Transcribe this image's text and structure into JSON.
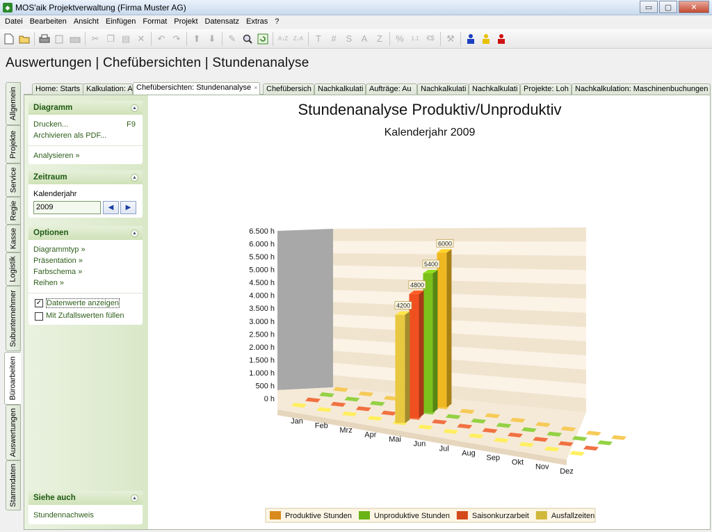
{
  "window": {
    "title": "MOS'aik Projektverwaltung (Firma Muster AG)",
    "app_icon": "app-logo-icon",
    "minimize": "▭",
    "maximize": "▢",
    "close": "✕"
  },
  "menu": [
    "Datei",
    "Bearbeiten",
    "Ansicht",
    "Einfügen",
    "Format",
    "Projekt",
    "Datensatz",
    "Extras",
    "?"
  ],
  "toolbar": {
    "icons": [
      "new-document-icon",
      "open-folder-icon",
      "print-icon",
      "print-preview-icon",
      "print-setup-icon",
      "cut-icon",
      "copy-icon",
      "paste-icon",
      "delete-icon",
      "undo-icon",
      "redo-icon",
      "move-up-icon",
      "move-down-icon",
      "edit-icon",
      "search-icon",
      "refresh-icon",
      "sort-ascending-icon",
      "sort-descending-icon",
      "text-format-icon",
      "hash-format-icon",
      "s-format-icon",
      "a-format-icon",
      "z-format-icon",
      "percent-icon",
      "decimal-format-icon",
      "currency-icon",
      "tools-icon",
      "user-blue-icon",
      "user-yellow-icon",
      "user-red-icon"
    ],
    "text_labels": {
      "sort_asc": "A↓Z",
      "sort_desc": "Z↓A",
      "T": "T",
      "hash": "#",
      "S": "S",
      "A": "A",
      "Z": "Z",
      "percent": "%",
      "decimal": "1.1",
      "currency": "€$"
    }
  },
  "breadcrumb": "Auswertungen | Chefübersichten | Stundenanalyse",
  "vertical_tabs": [
    "Allgemein",
    "Projekte",
    "Service",
    "Regie",
    "Kasse",
    "Logistik",
    "Subunternehmer",
    "Büroarbeiten",
    "Auswertungen",
    "Stammdaten"
  ],
  "active_vertical_tab": "Büroarbeiten",
  "tabs": [
    {
      "label": "Home: Starts",
      "active": false
    },
    {
      "label": "Kalkulation: A",
      "active": false
    },
    {
      "label": "Chefübersichten: Stundenanalyse",
      "active": true
    },
    {
      "label": "Chefübersich",
      "active": false
    },
    {
      "label": "Nachkalkulati",
      "active": false
    },
    {
      "label": "Aufträge: Au",
      "active": false
    },
    {
      "label": "Nachkalkulati",
      "active": false
    },
    {
      "label": "Nachkalkulati",
      "active": false
    },
    {
      "label": "Projekte: Loh",
      "active": false
    },
    {
      "label": "Nachkalkulation: Maschinenbuchungen",
      "active": false
    }
  ],
  "tab_close_glyph": "×",
  "sidebar": {
    "diagramm": {
      "title": "Diagramm",
      "print_label": "Drucken...",
      "print_key": "F9",
      "archive_label": "Archivieren als PDF...",
      "analyze_label": "Analysieren »"
    },
    "zeitraum": {
      "title": "Zeitraum",
      "year_label": "Kalenderjahr",
      "year_value": "2009",
      "prev_glyph": "◀",
      "next_glyph": "▶"
    },
    "optionen": {
      "title": "Optionen",
      "links": [
        "Diagrammtyp »",
        "Präsentation »",
        "Farbschema »",
        "Reihen »"
      ],
      "show_values_label": "Datenwerte anzeigen",
      "show_values_checked": true,
      "random_values_label": "Mit Zufallswerten füllen",
      "random_values_checked": false
    },
    "siehe_auch": {
      "title": "Siehe auch",
      "links": [
        "Stundennachweis"
      ]
    }
  },
  "chart_data": {
    "type": "bar",
    "title": "Stundenanalyse Produktiv/Unproduktiv",
    "subtitle": "Kalenderjahr 2009",
    "categories": [
      "Jan",
      "Feb",
      "Mrz",
      "Apr",
      "Mai",
      "Jun",
      "Jul",
      "Aug",
      "Sep",
      "Okt",
      "Nov",
      "Dez"
    ],
    "y_ticks": [
      "0 h",
      "500 h",
      "1.000 h",
      "1.500 h",
      "2.000 h",
      "2.500 h",
      "3.000 h",
      "3.500 h",
      "4.000 h",
      "4.500 h",
      "5.000 h",
      "5.500 h",
      "6.000 h",
      "6.500 h"
    ],
    "ylim": [
      0,
      6500
    ],
    "series": [
      {
        "name": "Produktive Stunden",
        "color": "#f0b820",
        "values": [
          0,
          0,
          0,
          0,
          6000,
          0,
          0,
          0,
          0,
          0,
          0,
          0
        ],
        "labels": [
          "",
          "",
          "",
          "",
          "6000",
          "",
          "",
          "",
          "",
          "",
          "",
          ""
        ]
      },
      {
        "name": "Unproduktive Stunden",
        "color": "#7cc01c",
        "values": [
          0,
          0,
          0,
          0,
          5400,
          0,
          0,
          0,
          0,
          0,
          0,
          0
        ],
        "labels": [
          "",
          "",
          "",
          "",
          "5400",
          "",
          "",
          "",
          "",
          "",
          "",
          ""
        ]
      },
      {
        "name": "Saisonkurzarbeit",
        "color": "#f05020",
        "values": [
          0,
          0,
          0,
          0,
          4800,
          0,
          0,
          0,
          0,
          0,
          0,
          0
        ],
        "labels": [
          "",
          "",
          "",
          "",
          "4800",
          "",
          "",
          "",
          "",
          "",
          "",
          ""
        ]
      },
      {
        "name": "Ausfallzeiten",
        "color": "#e8c840",
        "values": [
          0,
          0,
          0,
          0,
          4200,
          0,
          0,
          0,
          0,
          0,
          0,
          0
        ],
        "labels": [
          "",
          "",
          "",
          "",
          "4200",
          "",
          "",
          "",
          "",
          "",
          "",
          ""
        ]
      }
    ],
    "legend_colors": [
      "#d88a1c",
      "#6ab416",
      "#d44a1c",
      "#d0b83c"
    ],
    "legend": "bottom",
    "grid": true,
    "style": "3d"
  }
}
